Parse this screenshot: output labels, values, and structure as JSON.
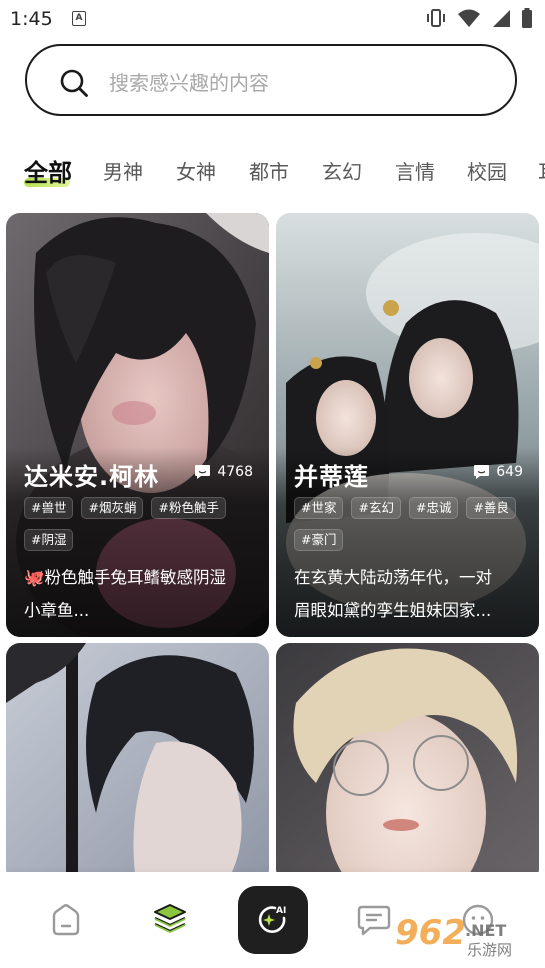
{
  "status_bar": {
    "time": "1:45",
    "notification_icon": "A",
    "icons": [
      "vibrate-icon",
      "wifi-icon",
      "signal-icon",
      "battery-icon"
    ]
  },
  "search": {
    "placeholder": "搜索感兴趣的内容"
  },
  "tabs": [
    {
      "label": "全部",
      "active": true
    },
    {
      "label": "男神",
      "active": false
    },
    {
      "label": "女神",
      "active": false
    },
    {
      "label": "都市",
      "active": false
    },
    {
      "label": "玄幻",
      "active": false
    },
    {
      "label": "言情",
      "active": false
    },
    {
      "label": "校园",
      "active": false
    },
    {
      "label": "耳",
      "active": false
    }
  ],
  "cards": [
    {
      "name": "达米安.柯林",
      "count": "4768",
      "tags_row1": [
        "#兽世",
        "#烟灰蛸",
        "#粉色触手"
      ],
      "tags_row2": [
        "#阴湿"
      ],
      "desc_line1": "🐙粉色触手兔耳鳍敏感阴湿",
      "desc_line2": "小章鱼..."
    },
    {
      "name": "并蒂莲",
      "count": "649",
      "tags_row1": [
        "#世家",
        "#玄幻",
        "#忠诚",
        "#善良"
      ],
      "tags_row2": [
        "#豪门"
      ],
      "desc_line1": "在玄黄大陆动荡年代，一对",
      "desc_line2": "眉眼如黛的孪生姐妹因家..."
    },
    {},
    {}
  ],
  "bottom_nav": {
    "items": [
      "home-icon",
      "layers-icon",
      "ai-create-icon",
      "message-icon",
      "profile-icon"
    ],
    "active": "layers-icon",
    "ai_label": "AI"
  },
  "watermark": {
    "brand": "962",
    "suffix": ".NET",
    "subtitle": "乐游网"
  },
  "colors": {
    "accent": "#b5e14f",
    "nav_active": "#8cc63f",
    "ai_button": "#1f1f1f"
  }
}
